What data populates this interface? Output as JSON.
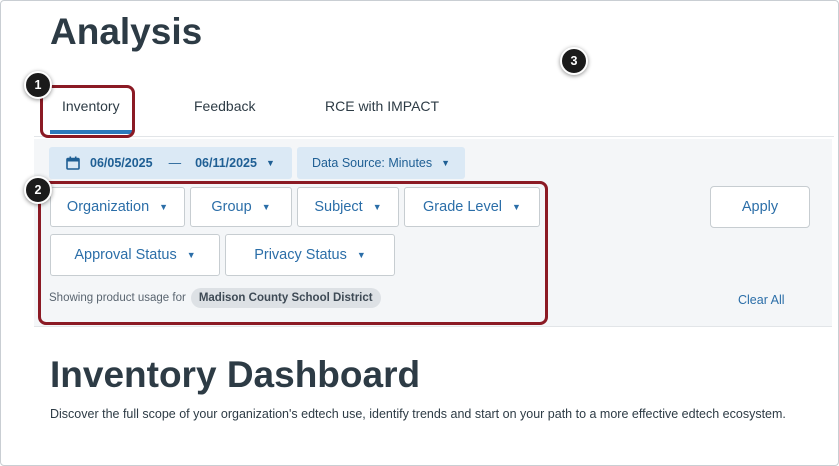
{
  "page": {
    "title": "Analysis"
  },
  "tabs": [
    {
      "label": "Inventory",
      "selected": true
    },
    {
      "label": "Feedback",
      "selected": false
    },
    {
      "label": "RCE with IMPACT",
      "selected": false
    }
  ],
  "filters": {
    "date_start": "06/05/2025",
    "date_separator": "—",
    "date_end": "06/11/2025",
    "data_source_label": "Data Source: Minutes",
    "buttons": {
      "organization": "Organization",
      "group": "Group",
      "subject": "Subject",
      "grade_level": "Grade Level",
      "approval_status": "Approval Status",
      "privacy_status": "Privacy Status"
    },
    "apply_label": "Apply",
    "clear_all_label": "Clear All",
    "showing_prefix": "Showing product usage for",
    "showing_value": "Madison County School District"
  },
  "dashboard": {
    "title": "Inventory Dashboard",
    "description": "Discover the full scope of your organization's edtech use, identify trends and start on your path to a more effective edtech ecosystem."
  },
  "callouts": {
    "c1": "1",
    "c2": "2",
    "c3": "3"
  },
  "colors": {
    "accent": "#2b7abc",
    "link": "#2b6ea8",
    "callout_border": "#8b1a24",
    "heading": "#2d3b45"
  }
}
